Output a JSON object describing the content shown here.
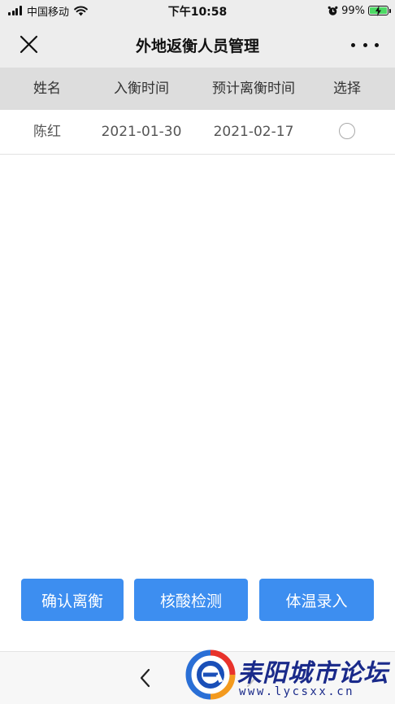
{
  "status_bar": {
    "carrier": "中国移动",
    "time": "下午10:58",
    "battery": "99%",
    "battery_level": 0.99
  },
  "nav": {
    "title": "外地返衡人员管理"
  },
  "table": {
    "headers": [
      "姓名",
      "入衡时间",
      "预计离衡时间",
      "选择"
    ],
    "rows": [
      {
        "name": "陈红",
        "enter_date": "2021-01-30",
        "leave_date": "2021-02-17",
        "selected": false
      }
    ]
  },
  "actions": {
    "confirm_leave": "确认离衡",
    "nucleic_test": "核酸检测",
    "temperature_entry": "体温录入"
  },
  "watermark": {
    "name": "耒阳城市论坛",
    "url": "www.lycsxx.cn"
  },
  "colors": {
    "accent": "#3d8ef0",
    "header_bg": "#dddddd",
    "nav_bg": "#ededed",
    "watermark_blue": "#1a2a8a",
    "watermark_red": "#e8322b",
    "watermark_orange": "#f39a1e"
  },
  "icons": {
    "close": "close-icon",
    "more": "more-dots-icon",
    "back": "chevron-left-icon",
    "forward": "chevron-right-icon",
    "wifi": "wifi-icon",
    "alarm": "alarm-icon",
    "signal": "signal-bars-icon",
    "battery": "battery-charging-icon"
  }
}
